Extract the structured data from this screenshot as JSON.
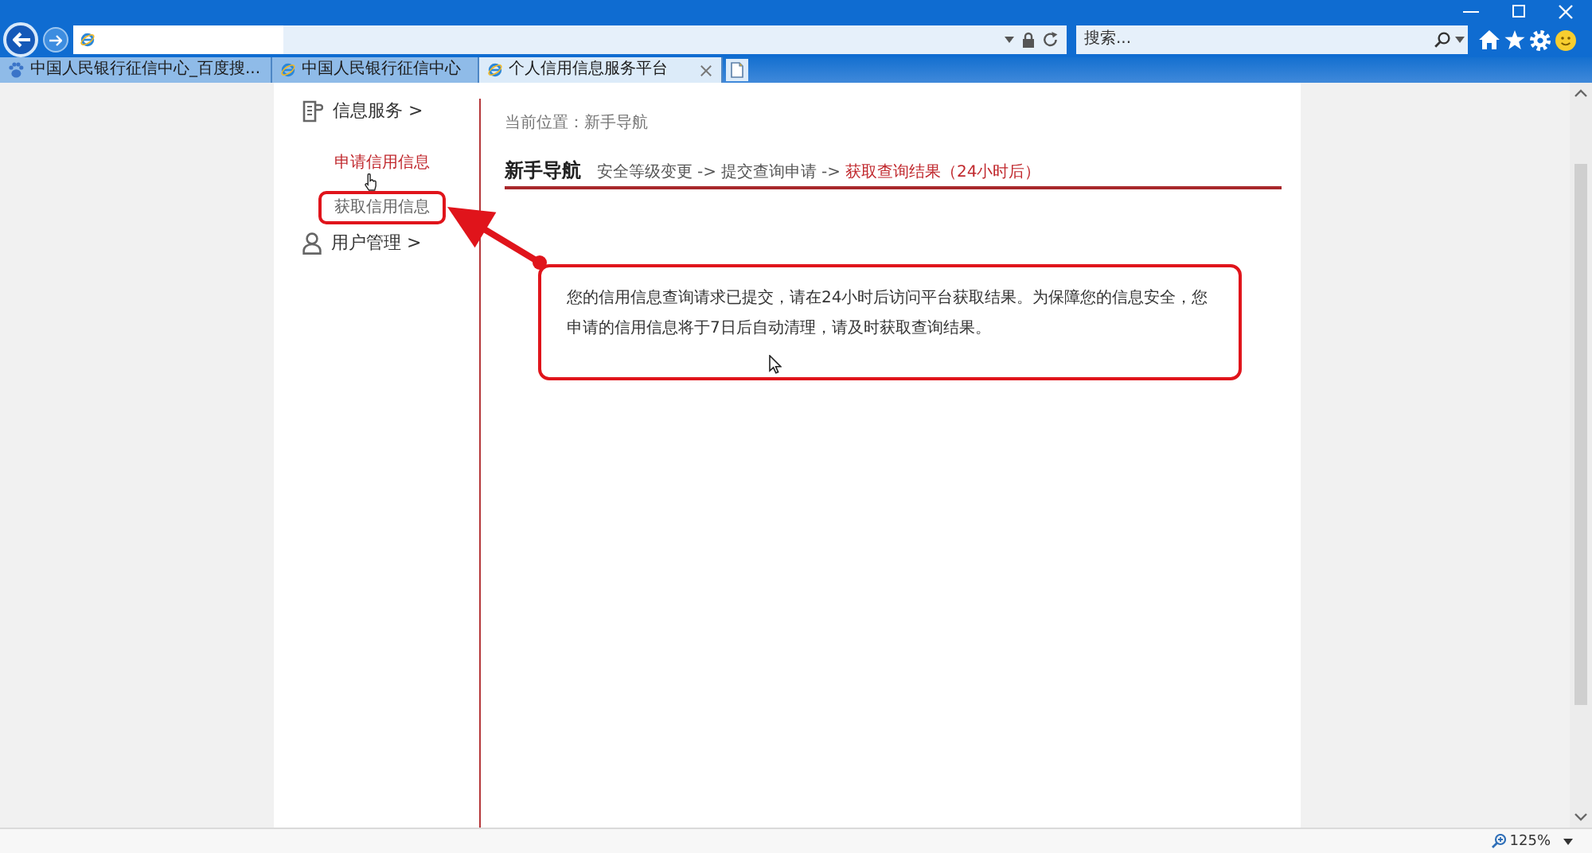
{
  "browser": {
    "search": {
      "placeholder": "搜索..."
    }
  },
  "tabs": [
    {
      "label": "中国人民银行征信中心_百度搜...",
      "selected": false
    },
    {
      "label": "中国人民银行征信中心",
      "selected": false
    },
    {
      "label": "个人信用信息服务平台",
      "selected": true
    }
  ],
  "sidebar": [
    {
      "label": "信息服务 >",
      "children": [
        {
          "label": "申请信用信息",
          "selected": true,
          "highlighted": false
        },
        {
          "label": "获取信用信息",
          "selected": false,
          "highlighted": true
        }
      ]
    },
    {
      "label": "用户管理 >"
    }
  ],
  "breadcrumb": "当前位置：新手导航",
  "guide": {
    "title": "新手导航",
    "steps": [
      {
        "label": "安全等级变更",
        "arrow": "->",
        "current": false
      },
      {
        "label": "提交查询申请",
        "arrow": "->",
        "current": false
      },
      {
        "label": "获取查询结果（24小时后）",
        "current": true
      }
    ]
  },
  "notice": {
    "text": "您的信用信息查询请求已提交，请在24小时后访问平台获取结果。为保障您的信息安全，您申请的信用信息将于7日后自动清理，请及时获取查询结果。",
    "highlighted": true
  },
  "status_bar": {
    "zoom": "125%"
  }
}
